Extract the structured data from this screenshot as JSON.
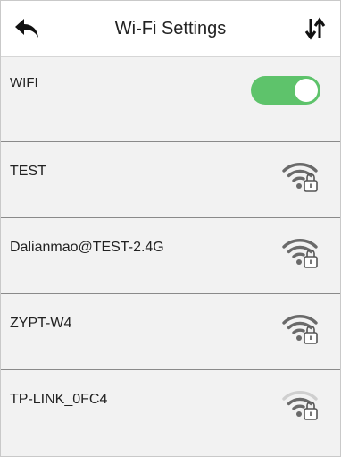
{
  "header": {
    "title": "Wi-Fi Settings",
    "back_icon": "back-arrow-icon",
    "sort_icon": "sort-arrows-icon"
  },
  "wifi_toggle": {
    "label": "WIFI",
    "state": "on",
    "color": "#5ec36b"
  },
  "networks": [
    {
      "ssid": "TEST",
      "icon": "wifi-locked-icon",
      "signal": "strong"
    },
    {
      "ssid": "Dalianmao@TEST-2.4G",
      "icon": "wifi-locked-icon",
      "signal": "strong"
    },
    {
      "ssid": "ZYPT-W4",
      "icon": "wifi-locked-icon",
      "signal": "strong"
    },
    {
      "ssid": "TP-LINK_0FC4",
      "icon": "wifi-locked-icon",
      "signal": "weak"
    }
  ]
}
